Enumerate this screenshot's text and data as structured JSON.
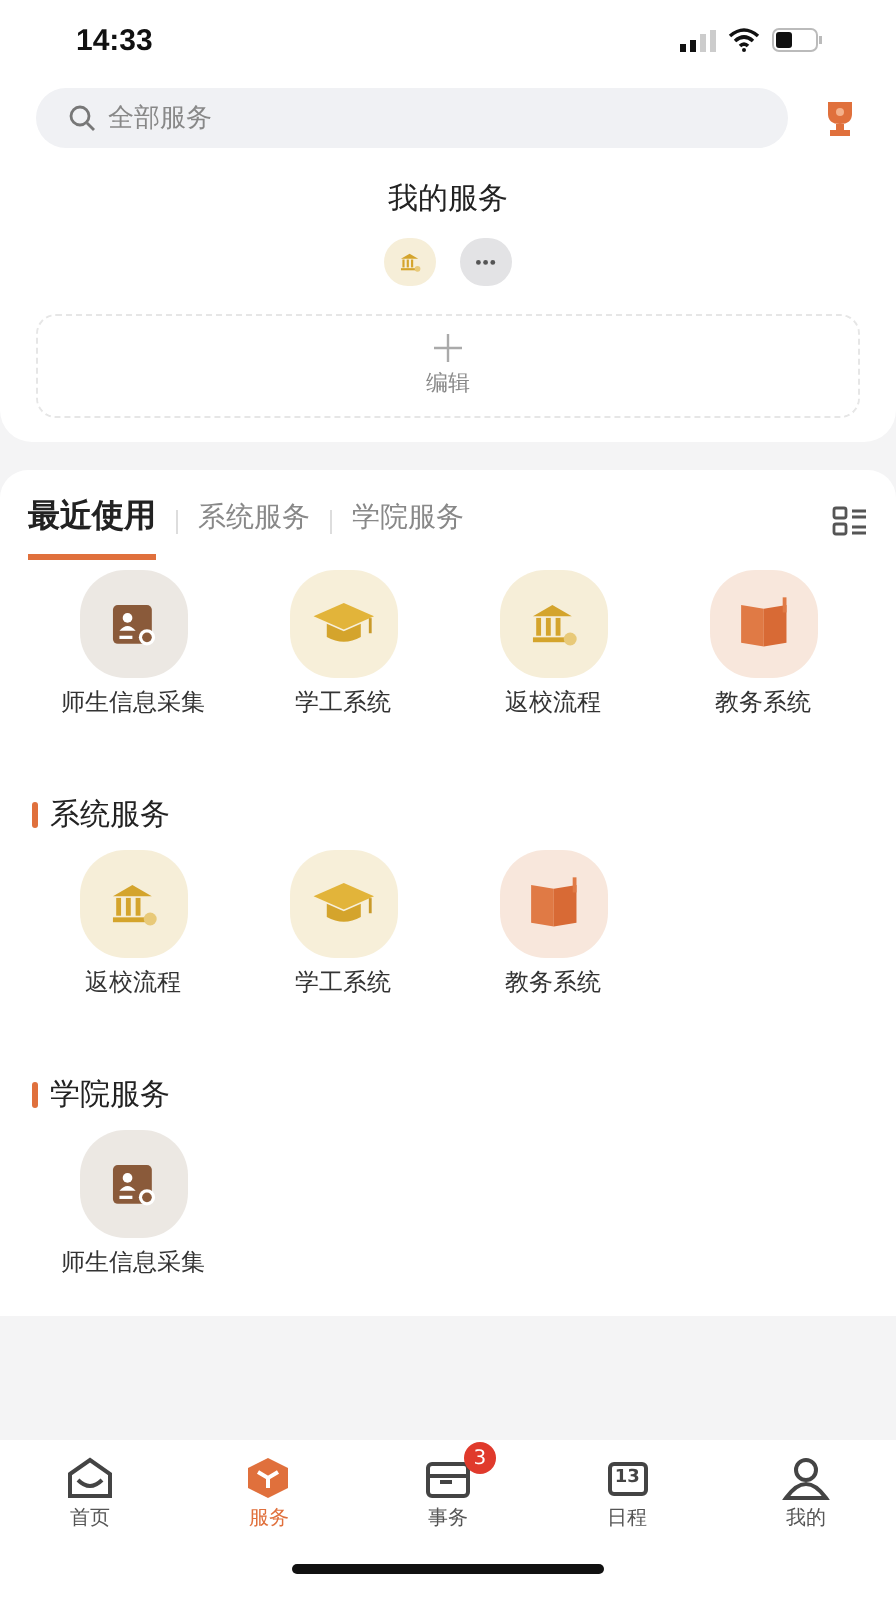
{
  "status_bar": {
    "time": "14:33"
  },
  "search": {
    "placeholder": "全部服务"
  },
  "my_services": {
    "title": "我的服务",
    "items": [
      {
        "kind": "bank"
      },
      {
        "kind": "more"
      }
    ],
    "edit_label": "编辑"
  },
  "tabs": [
    {
      "label": "最近使用",
      "selected": true
    },
    {
      "label": "系统服务",
      "selected": false
    },
    {
      "label": "学院服务",
      "selected": false
    }
  ],
  "recent": [
    {
      "label": "师生信息采集",
      "kind": "idcard"
    },
    {
      "label": "学工系统",
      "kind": "cap"
    },
    {
      "label": "返校流程",
      "kind": "bank"
    },
    {
      "label": "教务系统",
      "kind": "book"
    }
  ],
  "sections": [
    {
      "title": "系统服务",
      "items": [
        {
          "label": "返校流程",
          "kind": "bank"
        },
        {
          "label": "学工系统",
          "kind": "cap"
        },
        {
          "label": "教务系统",
          "kind": "book"
        }
      ]
    },
    {
      "title": "学院服务",
      "items": [
        {
          "label": "师生信息采集",
          "kind": "idcard"
        }
      ]
    }
  ],
  "nav": [
    {
      "label": "首页",
      "kind": "home",
      "selected": false
    },
    {
      "label": "服务",
      "kind": "box",
      "selected": true
    },
    {
      "label": "事务",
      "kind": "tray",
      "selected": false,
      "badge": "3"
    },
    {
      "label": "日程",
      "kind": "calendar",
      "selected": false,
      "icon_text": "13"
    },
    {
      "label": "我的",
      "kind": "person",
      "selected": false
    }
  ]
}
